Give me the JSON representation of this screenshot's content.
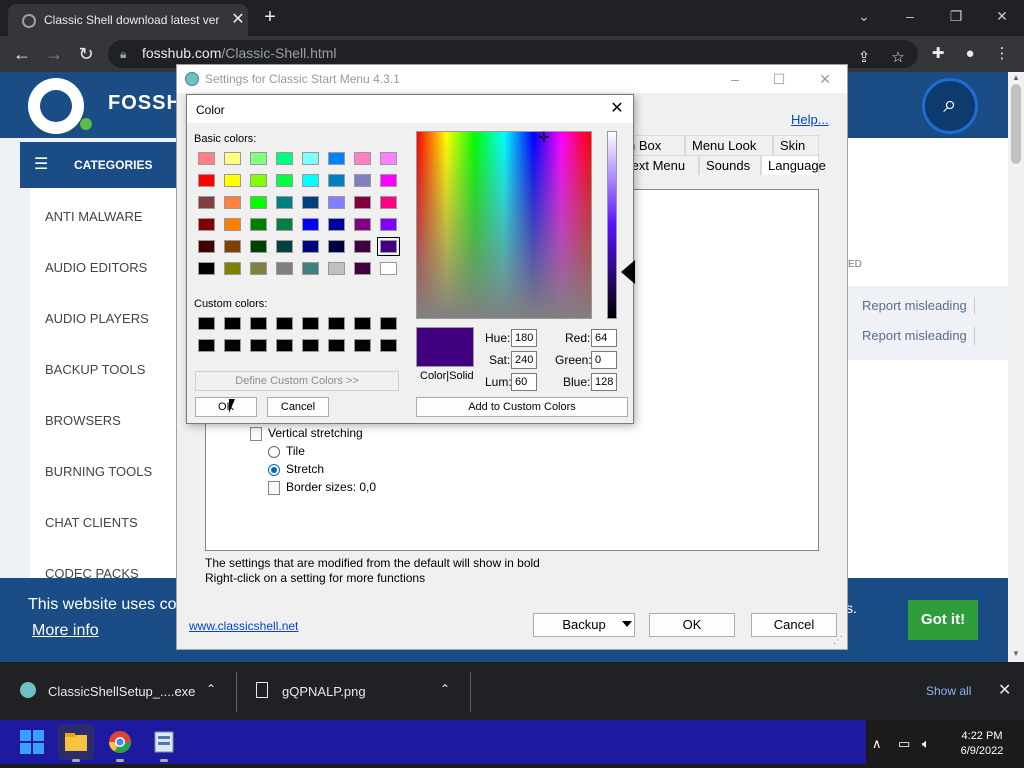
{
  "browser": {
    "tab_title": "Classic Shell download latest ver",
    "url_host": "fosshub.com",
    "url_path": "/Classic-Shell.html",
    "icons": [
      "back-arrow-icon",
      "forward-arrow-icon",
      "reload-icon",
      "lock-icon",
      "share-icon",
      "star-icon",
      "extensions-icon",
      "profile-icon",
      "kebab-menu-icon"
    ]
  },
  "site": {
    "logo_text": "FOSSH",
    "categories_label": "CATEGORIES",
    "categories": [
      "ANTI MALWARE",
      "AUDIO EDITORS",
      "AUDIO PLAYERS",
      "BACKUP TOOLS",
      "BROWSERS",
      "BURNING TOOLS",
      "CHAT CLIENTS",
      "CODEC PACKS"
    ],
    "ed_text": "ED",
    "report_links": [
      "Report misleading",
      "Report misleading"
    ],
    "cookie_text": "This website uses co",
    "cookie_more": "More info",
    "cookie_tail": "s.",
    "got_it": "Got it!",
    "accent": "#1a4c86",
    "button_green": "#2e9e3d"
  },
  "settings_window": {
    "title": "Settings for Classic Start Menu 4.3.1",
    "help": "Help...",
    "tabs_row1": [
      "h Box",
      "Menu Look",
      "Skin"
    ],
    "tabs_row2": [
      "text Menu",
      "Sounds",
      "Language"
    ],
    "tree": {
      "vertical_stretching": "Vertical stretching",
      "tile": "Tile",
      "stretch": "Stretch",
      "border_sizes": "Border sizes: 0,0"
    },
    "note1": "The settings that are modified from the default will show in bold",
    "note2": "Right-click on a setting for more functions",
    "link": "www.classicshell.net",
    "backup": "Backup",
    "ok": "OK",
    "cancel": "Cancel"
  },
  "color_dialog": {
    "title": "Color",
    "basic_label": "Basic colors:",
    "custom_label": "Custom colors:",
    "define_btn": "Define Custom Colors >>",
    "ok": "OK",
    "cancel": "Cancel",
    "color_solid": "Color|Solid",
    "hue_label": "Hue:",
    "sat_label": "Sat:",
    "lum_label": "Lum:",
    "red_label": "Red:",
    "green_label": "Green:",
    "blue_label": "Blue:",
    "hue": "180",
    "sat": "240",
    "lum": "60",
    "red": "64",
    "green": "0",
    "blue": "128",
    "add_btn": "Add to Custom Colors",
    "selected_color": "#400080",
    "selected_index": 39,
    "basic_colors": [
      "#ff8080",
      "#ffff80",
      "#80ff80",
      "#00ff80",
      "#80ffff",
      "#0080ff",
      "#ff80c0",
      "#ff80ff",
      "#ff0000",
      "#ffff00",
      "#80ff00",
      "#00ff40",
      "#00ffff",
      "#0080c0",
      "#8080c0",
      "#ff00ff",
      "#804040",
      "#ff8040",
      "#00ff00",
      "#008080",
      "#004080",
      "#8080ff",
      "#800040",
      "#ff0080",
      "#800000",
      "#ff8000",
      "#008000",
      "#008040",
      "#0000ff",
      "#0000a0",
      "#800080",
      "#8000ff",
      "#400000",
      "#804000",
      "#004000",
      "#004040",
      "#000080",
      "#000040",
      "#400040",
      "#400080",
      "#000000",
      "#808000",
      "#808040",
      "#808080",
      "#408080",
      "#c0c0c0",
      "#400040",
      "#ffffff"
    ],
    "custom_colors": [
      "#000000",
      "#000000",
      "#000000",
      "#000000",
      "#000000",
      "#000000",
      "#000000",
      "#000000",
      "#000000",
      "#000000",
      "#000000",
      "#000000",
      "#000000",
      "#000000",
      "#000000",
      "#000000"
    ]
  },
  "downloads": {
    "item1": "ClassicShellSetup_....exe",
    "item2": "gQPNALP.png",
    "show_all": "Show all"
  },
  "taskbar": {
    "time": "4:22 PM",
    "date": "6/9/2022",
    "apps": [
      "windows-start-icon",
      "file-explorer-icon",
      "chrome-icon",
      "classic-shell-settings-icon"
    ]
  }
}
